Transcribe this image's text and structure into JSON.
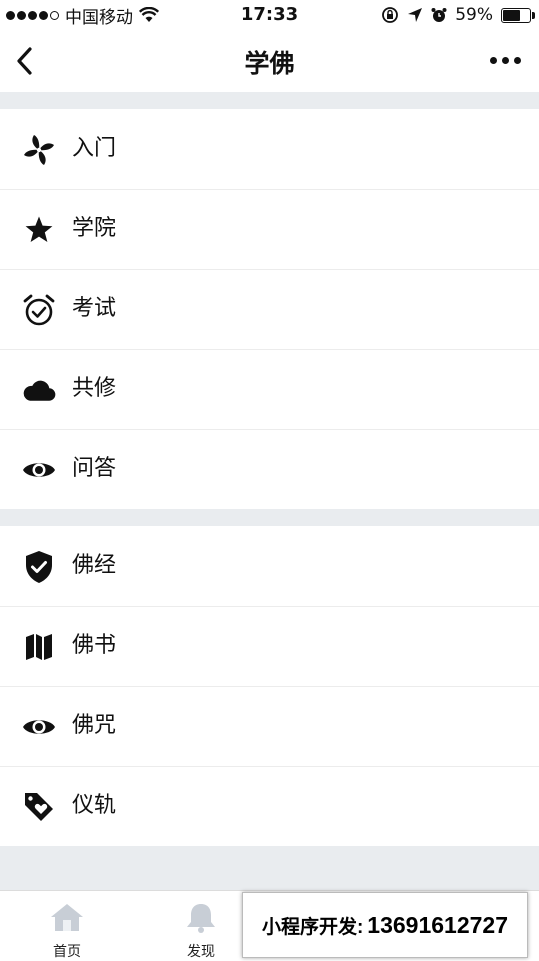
{
  "status_bar": {
    "carrier": "中国移动",
    "time": "17:33",
    "battery": "59%",
    "battery_level": 0.59
  },
  "nav": {
    "title": "学佛",
    "back_icon": "chevron-left-icon",
    "more_icon": "more-dots-icon"
  },
  "groups": [
    {
      "items": [
        {
          "label": "入门",
          "icon": "pinwheel-icon"
        },
        {
          "label": "学院",
          "icon": "star-icon"
        },
        {
          "label": "考试",
          "icon": "alarm-clock-icon"
        },
        {
          "label": "共修",
          "icon": "cloud-icon"
        },
        {
          "label": "问答",
          "icon": "eye-icon"
        }
      ]
    },
    {
      "items": [
        {
          "label": "佛经",
          "icon": "shield-check-icon"
        },
        {
          "label": "佛书",
          "icon": "map-icon"
        },
        {
          "label": "佛咒",
          "icon": "eye-icon"
        },
        {
          "label": "仪轨",
          "icon": "tag-heart-icon"
        }
      ]
    }
  ],
  "tabbar": {
    "tabs": [
      {
        "label": "首页",
        "icon": "home-icon"
      },
      {
        "label": "发现",
        "icon": "bell-icon"
      }
    ]
  },
  "overlay": {
    "label": "小程序开发:",
    "phone": "13691612727"
  }
}
